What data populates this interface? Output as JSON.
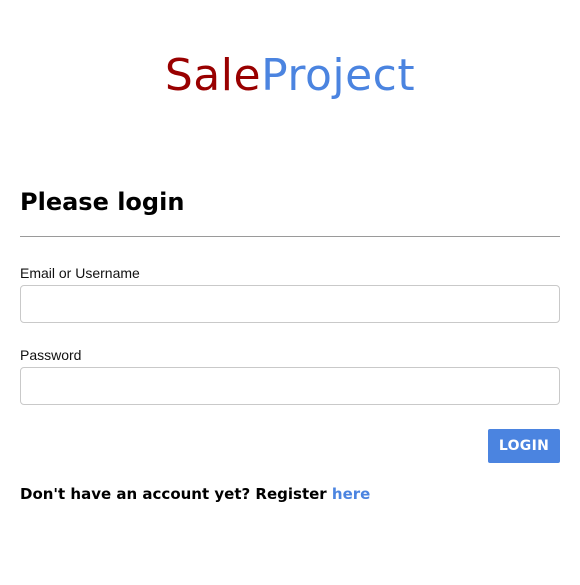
{
  "logo": {
    "part1": "Sale",
    "part2": "Project",
    "color_part1": "#990000",
    "color_part2": "#4b84e0"
  },
  "login_form": {
    "heading": "Please login",
    "email_label": "Email or Username",
    "email_value": "",
    "password_label": "Password",
    "password_value": "",
    "submit_label": "LOGIN",
    "accent_color": "#4b84e0"
  },
  "register": {
    "prompt": "Don't have an account yet? Register ",
    "link_text": "here"
  }
}
